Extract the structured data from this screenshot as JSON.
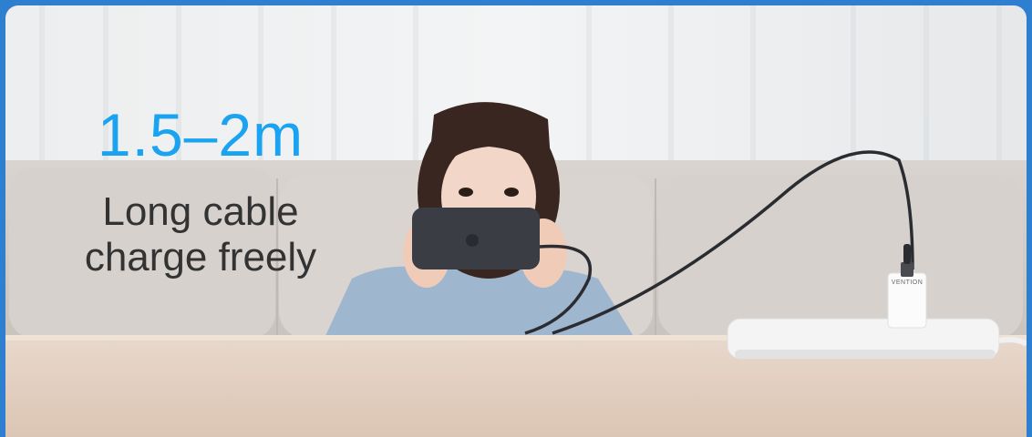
{
  "headline": "1.5–2m",
  "caption": {
    "line1": "Long cable",
    "line2": "charge freely"
  },
  "charger_brand": "VENTION",
  "colors": {
    "frame": "#2f7fd0",
    "headline": "#1aa3f0",
    "caption": "#333333"
  }
}
